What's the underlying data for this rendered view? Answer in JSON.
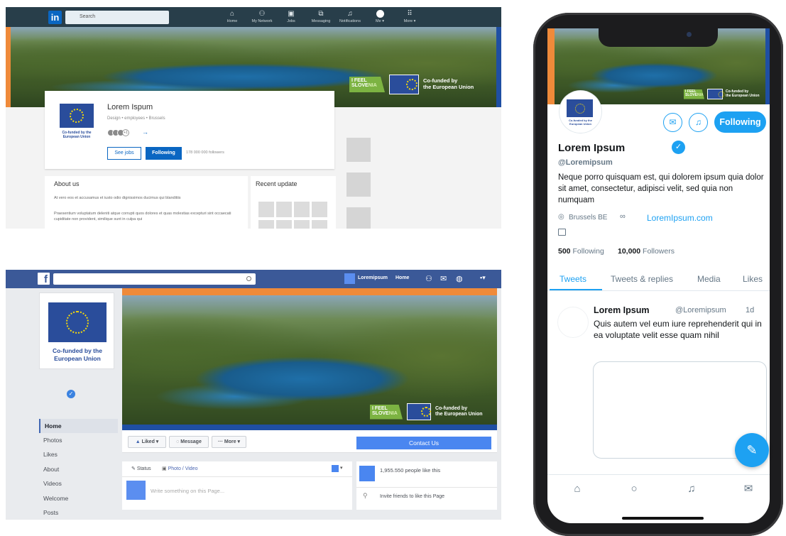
{
  "linkedin": {
    "logo": "in",
    "search_placeholder": "Search",
    "nav": [
      {
        "label": "Home",
        "icon": "home-icon"
      },
      {
        "label": "My Network",
        "icon": "network-icon"
      },
      {
        "label": "Jobs",
        "icon": "briefcase-icon"
      },
      {
        "label": "Messaging",
        "icon": "messaging-icon"
      },
      {
        "label": "Notifications",
        "icon": "bell-icon"
      },
      {
        "label": "Me ▾",
        "icon": "avatar"
      },
      {
        "label": "More ▾",
        "icon": "grid-icon"
      }
    ],
    "company_name": "Lorem Ispum",
    "company_meta": "Design • employees • Brussels",
    "connections_extra": "+1",
    "logo_caption": "Co-funded by the European Union",
    "see_jobs": "See jobs",
    "following": "Following",
    "followers": "178 000 000 followers",
    "about_title": "About us",
    "about_p1": "At vero eos et accusamus et iusto odio dignissimos ducimus qui blanditiis",
    "about_p2": "Praesentium voluptatum deleniti atque corrupti quos dolores et quas molestias excepturi sint occaecati cupiditate non provident, similique sunt in culpa qui",
    "recent_title": "Recent update"
  },
  "banner": {
    "ifs_line1": "I FEEL",
    "ifs_line2a": "S",
    "ifs_line2b": "LOVE",
    "ifs_line2c": "NIA",
    "caption_line1": "Co-funded by",
    "caption_line2": "the European Union"
  },
  "facebook": {
    "logo": "f",
    "user": "Loremipsum",
    "home": "Home",
    "profile_caption": "Co-funded by the European Union",
    "nav": [
      "Home",
      "Photos",
      "Likes",
      "About",
      "Videos",
      "Welcome",
      "Posts"
    ],
    "liked": "Liked ▾",
    "message": "Message",
    "more": "··· More ▾",
    "contact": "Contact Us",
    "status": "Status",
    "photo_video": "Photo / Video",
    "write_placeholder": "Write something on this Page...",
    "likes_count": "1,955.550 people like this",
    "invite": "Invite friends to like this Page"
  },
  "twitter": {
    "following_button": "Following",
    "name": "Lorem Ipsum",
    "handle": "@Loremipsum",
    "bio": "Neque porro quisquam est, qui dolorem ipsum quia dolor sit amet, consectetur, adipisci velit, sed quia non numquam",
    "location": "Brussels BE",
    "link": "LoremIpsum.com",
    "following_count": "500",
    "following_label": "Following",
    "followers_count": "10,000",
    "followers_label": "Followers",
    "tabs": [
      "Tweets",
      "Tweets & replies",
      "Media",
      "Likes"
    ],
    "tweet": {
      "name": "Lorem Ipsum",
      "handle": "@Loremipsum",
      "time": "1d",
      "text": "Quis autem vel eum iure reprehenderit qui in ea voluptate velit esse quam nihil"
    }
  },
  "colors": {
    "linkedin_bar": "#283e4a",
    "linkedin_blue": "#0a66c2",
    "facebook_blue": "#3b5998",
    "twitter_blue": "#1da1f2",
    "eu_blue": "#2a4d9b",
    "eu_star": "#f5d90a",
    "accent_orange": "#ef8a3a"
  }
}
